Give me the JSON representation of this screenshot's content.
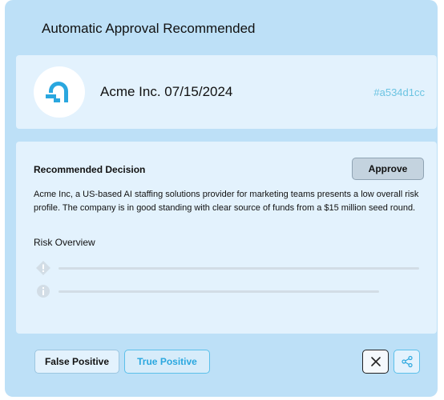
{
  "header": {
    "title": "Automatic Approval Recommended"
  },
  "company": {
    "name_date": "Acme Inc. 07/15/2024",
    "hash": "#a534d1cc",
    "logo_icon": "acme-logo-icon"
  },
  "decision": {
    "title": "Recommended Decision",
    "action_label": "Approve",
    "summary": "Acme Inc, a US-based AI staffing solutions provider for marketing teams presents a low overall risk profile. The company is in good standing with clear source of funds from a $15 million seed round.",
    "risk_title": "Risk Overview",
    "risk_items": [
      {
        "icon": "warning-diamond-icon"
      },
      {
        "icon": "info-circle-icon"
      }
    ]
  },
  "footer": {
    "false_positive_label": "False Positive",
    "true_positive_label": "True Positive",
    "close_icon": "close-icon",
    "share_icon": "share-icon"
  },
  "colors": {
    "card_bg": "#bde0f7",
    "panel_bg": "#e3f2fd",
    "accent": "#2aa7df",
    "hash_text": "#6cc4e2"
  }
}
